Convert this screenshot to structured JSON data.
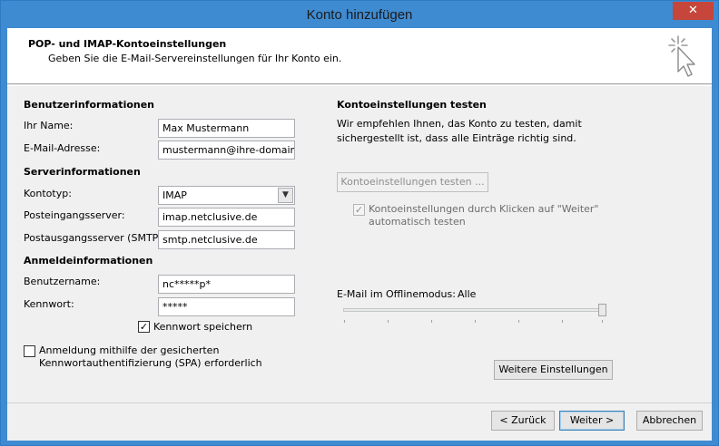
{
  "window": {
    "title": "Konto hinzufügen",
    "close_glyph": "✕"
  },
  "header": {
    "title": "POP- und IMAP-Kontoeinstellungen",
    "subtitle": "Geben Sie die E-Mail-Servereinstellungen für Ihr Konto ein.",
    "icon": "cursor-sparkle-icon"
  },
  "user_info": {
    "heading": "Benutzerinformationen",
    "name_label": "Ihr Name:",
    "name_value": "Max Mustermann",
    "email_label": "E-Mail-Adresse:",
    "email_value": "mustermann@ihre-domain.de"
  },
  "server_info": {
    "heading": "Serverinformationen",
    "account_type_label": "Kontotyp:",
    "account_type_value": "IMAP",
    "incoming_label": "Posteingangsserver:",
    "incoming_value": "imap.netclusive.de",
    "outgoing_label": "Postausgangsserver (SMTP):",
    "outgoing_value": "smtp.netclusive.de"
  },
  "login_info": {
    "heading": "Anmeldeinformationen",
    "username_label": "Benutzername:",
    "username_value": "nc*****p*",
    "password_label": "Kennwort:",
    "password_value": "*****",
    "remember_label": "Kennwort speichern",
    "remember_checked": true,
    "spa_label_line1": "Anmeldung mithilfe der gesicherten",
    "spa_label_line2": "Kennwortauthentifizierung (SPA) erforderlich",
    "spa_checked": false
  },
  "test_settings": {
    "heading": "Kontoeinstellungen testen",
    "desc_line1": "Wir empfehlen Ihnen, das Konto zu testen, damit",
    "desc_line2": "sichergestellt ist, dass alle Einträge richtig sind.",
    "test_button": "Kontoeinstellungen testen ...",
    "auto_test_line1": "Kontoeinstellungen durch Klicken auf \"Weiter\"",
    "auto_test_line2": "automatisch testen",
    "auto_test_checked": true
  },
  "offline": {
    "label": "E-Mail im Offlinemodus:",
    "value": "Alle",
    "slider_level": 1.0
  },
  "more_settings_button": "Weitere Einstellungen",
  "footer": {
    "back": "< Zurück",
    "next": "Weiter >",
    "cancel": "Abbrechen"
  },
  "check_glyph": "✓"
}
